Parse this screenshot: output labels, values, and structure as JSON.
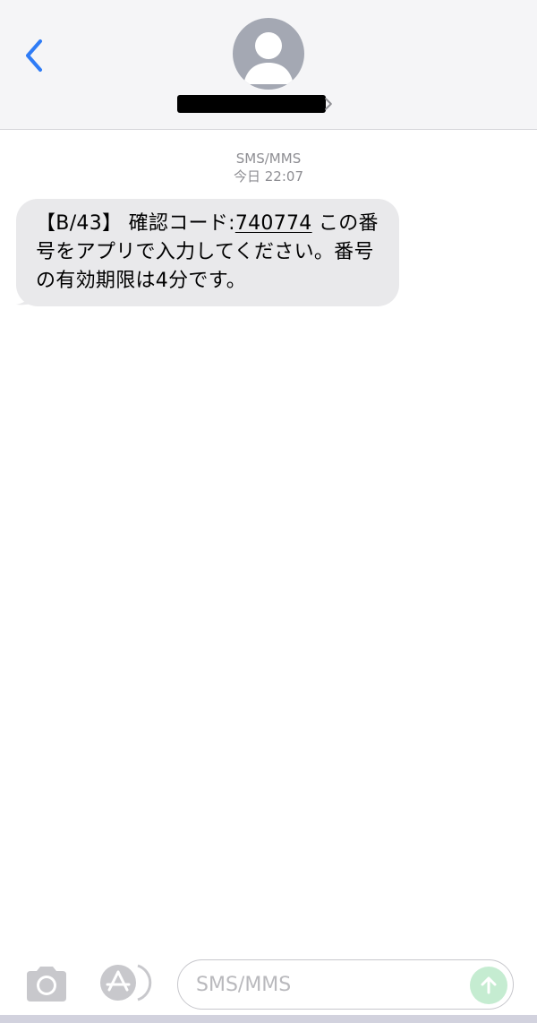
{
  "colors": {
    "accent": "#2f7cf6",
    "header_bg": "#f5f5f7",
    "bubble_bg": "#e9e9eb",
    "meta_text": "#8e8e93",
    "send_button": "#c5ecd1",
    "avatar_bg": "#a4a8b3"
  },
  "header": {
    "back_icon": "chevron-left-icon",
    "avatar_icon": "person-silhouette-icon",
    "contact_name": "",
    "contact_name_redacted": true,
    "details_icon": "chevron-right-icon"
  },
  "conversation": {
    "service": "SMS/MMS",
    "timestamp": "今日 22:07",
    "messages": [
      {
        "direction": "incoming",
        "prefix": "【B/43】 確認コード:",
        "code": "740774",
        "suffix": " この番号をアプリで入力してください。番号の有効期限は4分です。"
      }
    ]
  },
  "input_bar": {
    "camera_icon": "camera-icon",
    "appstore_icon": "app-store-icon",
    "placeholder": "SMS/MMS",
    "send_icon": "arrow-up-icon"
  }
}
